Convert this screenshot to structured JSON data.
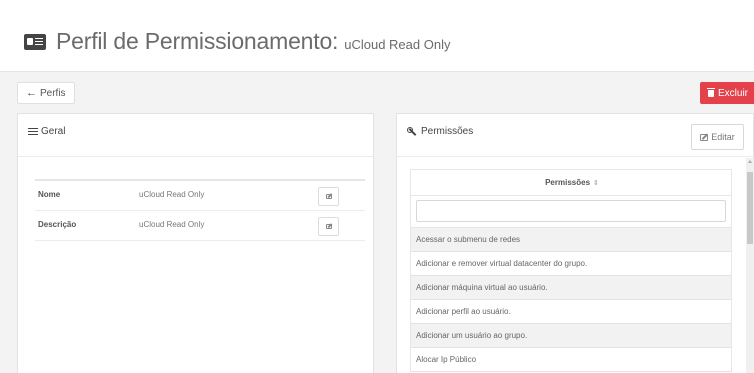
{
  "header": {
    "title": "Perfil de Permissionamento:",
    "subtitle": "uCloud Read Only"
  },
  "actions": {
    "back_label": "Perfis",
    "delete_label": "Excluir"
  },
  "general_panel": {
    "title": "Geral",
    "rows": [
      {
        "label": "Nome",
        "value": "uCloud Read Only"
      },
      {
        "label": "Descrição",
        "value": "uCloud Read Only"
      }
    ]
  },
  "permissions_panel": {
    "title": "Permissões",
    "edit_label": "Editar",
    "column_header": "Permissões",
    "filter_value": "",
    "rows": [
      "Acessar o submenu de redes",
      "Adicionar e remover virtual datacenter do grupo.",
      "Adicionar máquina virtual ao usuário.",
      "Adicionar perfil ao usuário.",
      "Adicionar um usuário ao grupo.",
      "Alocar Ip Público"
    ]
  },
  "colors": {
    "danger": "#e4414b",
    "background": "#f3f3f3",
    "panel": "#ffffff"
  }
}
